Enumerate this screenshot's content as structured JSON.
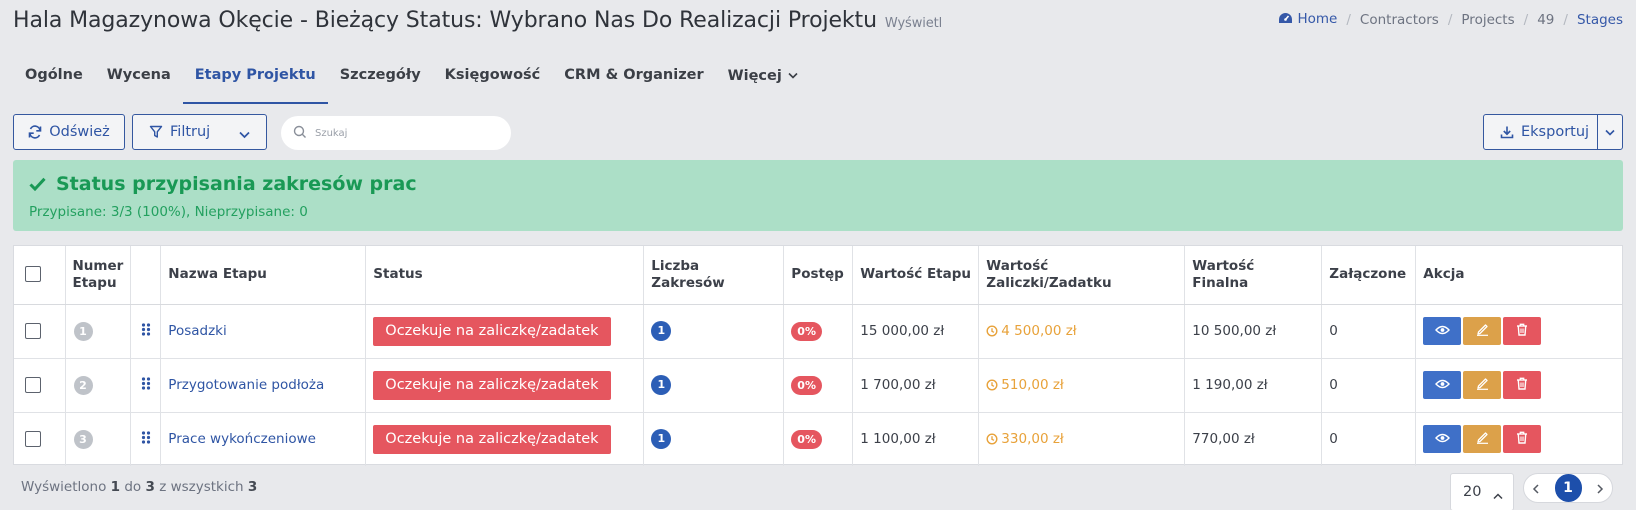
{
  "header": {
    "title": "Hala Magazynowa Okęcie - Bieżący Status: Wybrano Nas Do Realizacji Projektu",
    "subtitle": "Wyświetl",
    "breadcrumb": [
      "Home",
      "Contractors",
      "Projects",
      "49",
      "Stages"
    ]
  },
  "tabs": [
    {
      "label": "Ogólne"
    },
    {
      "label": "Wycena"
    },
    {
      "label": "Etapy Projektu",
      "active": true
    },
    {
      "label": "Szczegóły"
    },
    {
      "label": "Księgowość"
    },
    {
      "label": "CRM & Organizer"
    },
    {
      "label": "Więcej"
    }
  ],
  "toolbar": {
    "refresh_label": "Odśwież",
    "filter_label": "Filtruj",
    "search_placeholder": "Szukaj",
    "search_value": "",
    "export_label": "Eksportuj"
  },
  "alert": {
    "title": "Status przypisania zakresów prac",
    "text": "Przypisane: 3/3 (100%), Nieprzypisane: 0",
    "color": "#acdfc7"
  },
  "table": {
    "headers": {
      "number": "Numer Etapu",
      "name": "Nazwa Etapu",
      "status": "Status",
      "scopes": "Liczba Zakresów",
      "progress": "Postęp",
      "value": "Wartość Etapu",
      "deposit": "Wartość Zaliczki/Zadatku",
      "final": "Wartość Finalna",
      "attached": "Załączone",
      "action": "Akcja"
    },
    "rows": [
      {
        "number": "1",
        "name": "Posadzki",
        "status": "Oczekuje na zaliczkę/zadatek",
        "scopes": "1",
        "progress": "0%",
        "value": "15 000,00 zł",
        "deposit": "4 500,00 zł",
        "final": "10 500,00 zł",
        "attached": "0"
      },
      {
        "number": "2",
        "name": "Przygotowanie podłoża",
        "status": "Oczekuje na zaliczkę/zadatek",
        "scopes": "1",
        "progress": "0%",
        "value": "1 700,00 zł",
        "deposit": "510,00 zł",
        "final": "1 190,00 zł",
        "attached": "0"
      },
      {
        "number": "3",
        "name": "Prace wykończeniowe",
        "status": "Oczekuje na zaliczkę/zadatek",
        "scopes": "1",
        "progress": "0%",
        "value": "1 100,00 zł",
        "deposit": "330,00 zł",
        "final": "770,00 zł",
        "attached": "0"
      }
    ]
  },
  "footer": {
    "info_prefix": "Wyświetlono",
    "from": "1",
    "to_word": "do",
    "to": "3",
    "of_word": "z wszystkich",
    "total": "3",
    "page_size": "20",
    "current_page": "1"
  },
  "colors": {
    "accent": "#2f55a4",
    "danger": "#e5565f",
    "warning": "#dca14a",
    "success_text": "#199955"
  }
}
